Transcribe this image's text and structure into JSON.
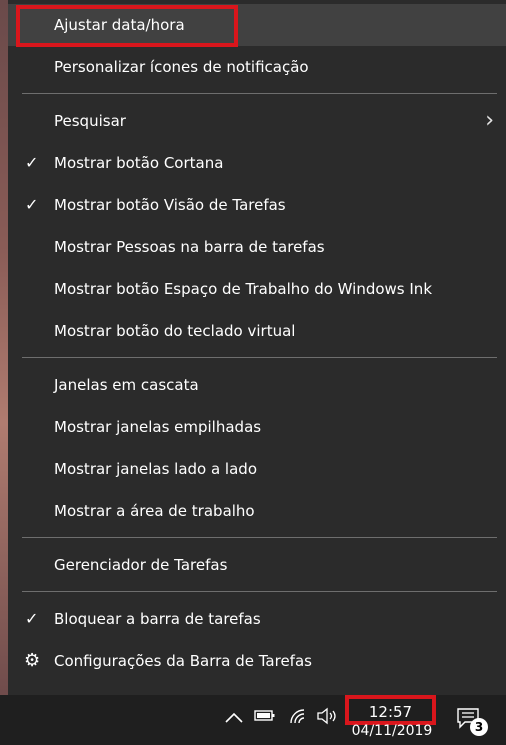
{
  "menu": {
    "items": [
      {
        "label": "Ajustar data/hora"
      },
      {
        "label": "Personalizar ícones de notificação"
      },
      {
        "label": "Pesquisar"
      },
      {
        "label": "Mostrar botão Cortana"
      },
      {
        "label": "Mostrar botão Visão de Tarefas"
      },
      {
        "label": "Mostrar Pessoas na barra de tarefas"
      },
      {
        "label": "Mostrar botão Espaço de Trabalho do Windows Ink"
      },
      {
        "label": "Mostrar botão do teclado virtual"
      },
      {
        "label": "Janelas em cascata"
      },
      {
        "label": "Mostrar janelas empilhadas"
      },
      {
        "label": "Mostrar janelas lado a lado"
      },
      {
        "label": "Mostrar a área de trabalho"
      },
      {
        "label": "Gerenciador de Tarefas"
      },
      {
        "label": "Bloquear a barra de tarefas"
      },
      {
        "label": "Configurações da Barra de Tarefas"
      }
    ],
    "checked_items": [
      "Mostrar botão Cortana",
      "Mostrar botão Visão de Tarefas",
      "Bloquear a barra de tarefas"
    ],
    "highlighted_item": "Ajustar data/hora"
  },
  "glyphs": {
    "check": "✓",
    "submenu_arrow": "›",
    "gear": "⚙"
  },
  "taskbar": {
    "clock_time": "12:57",
    "clock_date": "04/11/2019",
    "notification_count": "3",
    "tray_icons": [
      "chevron-up-icon",
      "battery-icon",
      "wifi-icon",
      "volume-icon",
      "action-center-icon"
    ]
  },
  "colors": {
    "menu_bg": "#2b2b2b",
    "hover_bg": "#414141",
    "separator": "#6e6e6e",
    "annotation_red": "#d9161c",
    "taskbar_bg": "#1f1f1f"
  }
}
